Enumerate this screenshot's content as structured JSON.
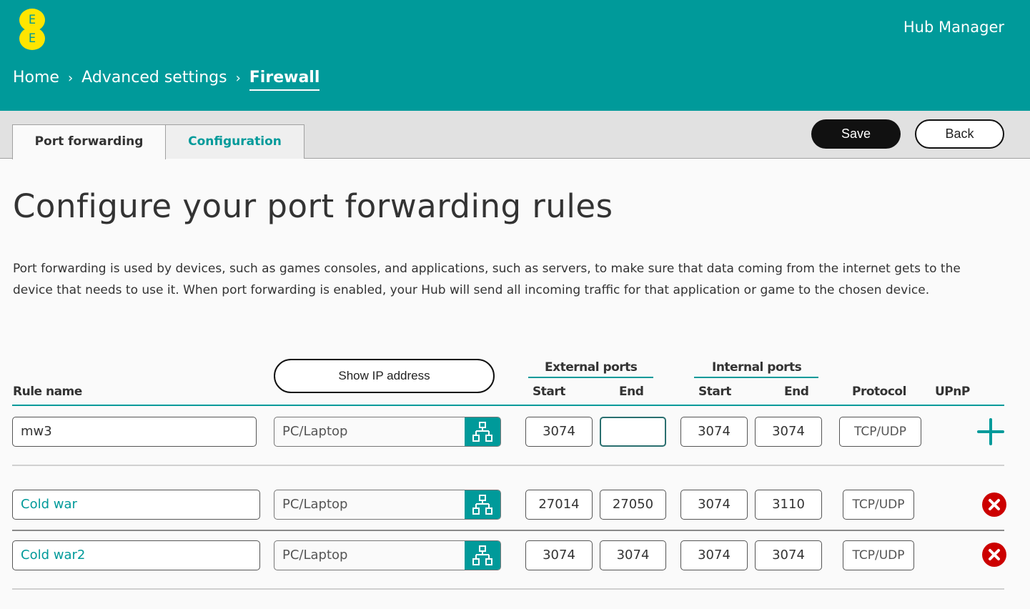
{
  "header": {
    "logo_letters": [
      "E",
      "E"
    ],
    "app_title": "Hub Manager",
    "breadcrumb": [
      {
        "label": "Home"
      },
      {
        "label": "Advanced settings"
      },
      {
        "label": "Firewall"
      }
    ],
    "separator": "›"
  },
  "tabs": [
    {
      "label": "Port forwarding",
      "active": true
    },
    {
      "label": "Configuration",
      "active": false
    }
  ],
  "toolbar": {
    "save_label": "Save",
    "back_label": "Back"
  },
  "page": {
    "title": "Configure your port forwarding rules",
    "intro": "Port forwarding is used by devices, such as games consoles, and applications, such as servers, to make sure that data coming from the internet gets to the device that needs to use it. When port forwarding is enabled, your Hub will send all incoming traffic for that application or game to the chosen device."
  },
  "table": {
    "columns": {
      "rule_name": "Rule name",
      "show_ip_button": "Show IP address",
      "external_ports": "External ports",
      "internal_ports": "Internal ports",
      "start": "Start",
      "end": "End",
      "protocol": "Protocol",
      "upnp": "UPnP"
    },
    "new_rule": {
      "rule_name": "mw3",
      "device": "PC/Laptop",
      "ext_start": "3074",
      "ext_end": "",
      "int_start": "3074",
      "int_end": "3074",
      "protocol": "TCP/UDP"
    },
    "rules": [
      {
        "rule_name": "Cold war",
        "device": "PC/Laptop",
        "ext_start": "27014",
        "ext_end": "27050",
        "int_start": "3074",
        "int_end": "3110",
        "protocol": "TCP/UDP"
      },
      {
        "rule_name": "Cold war2",
        "device": "PC/Laptop",
        "ext_start": "3074",
        "ext_end": "3074",
        "int_start": "3074",
        "int_end": "3074",
        "protocol": "TCP/UDP"
      }
    ]
  },
  "colors": {
    "brand_teal": "#009a9a",
    "logo_yellow": "#ffe500",
    "delete_red": "#cc0000"
  }
}
